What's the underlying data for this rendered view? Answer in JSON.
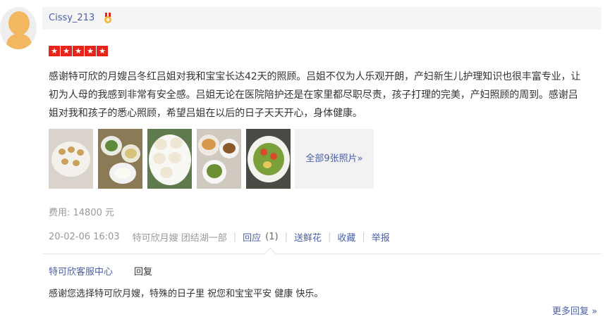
{
  "user": {
    "name": "Cissy_213",
    "medal_icon": "medal-icon"
  },
  "rating": {
    "stars": 5,
    "star_glyph": "★",
    "color": "#e5251c"
  },
  "review": {
    "text": "感谢特可欣的月嫂吕冬红吕姐对我和宝宝长达42天的照顾。吕姐不仅为人乐观开朗，产妇新生儿护理知识也很丰富专业，让初为人母的我感到非常有安全感。吕姐无论在医院陪护还是在家里都尽职尽责，孩子打理的完美，产妇照顾的周到。感谢吕姐对我和孩子的悉心照顾，希望吕姐在以后的日子天天开心，身体健康。"
  },
  "photos": {
    "count_text": "全部9张照片»"
  },
  "fee": {
    "text": "费用: 14800 元"
  },
  "meta": {
    "date": "20-02-06 16:03",
    "shop": "特可欣月嫂 团结湖一部",
    "reply_label": "回应",
    "reply_count": "(1)",
    "flower_label": "送鲜花",
    "favorite_label": "收藏",
    "report_label": "举报",
    "separator": "|"
  },
  "reply": {
    "author": "特可欣客服中心",
    "label": "回复",
    "text": "感谢您选择特可欣月嫂，特殊的日子里 祝您和宝宝平安 健康 快乐。",
    "more_label": "更多回复 »"
  },
  "colors": {
    "link": "#4a5fa6",
    "muted": "#999999",
    "header_bg": "#f5f5f5"
  }
}
